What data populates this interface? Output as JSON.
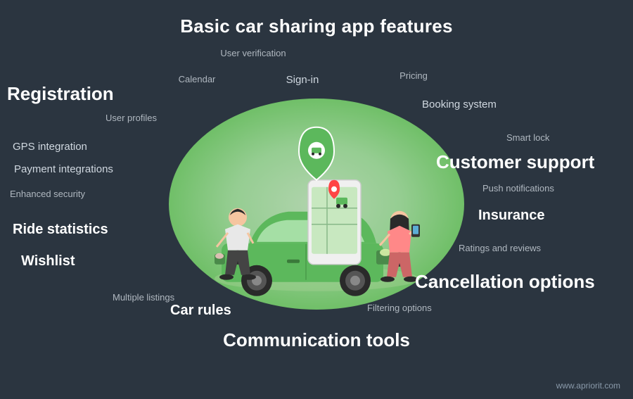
{
  "title": "Basic car sharing app features",
  "features": {
    "registration": "Registration",
    "user_verification": "User verification",
    "calendar": "Calendar",
    "sign_in": "Sign-in",
    "pricing": "Pricing",
    "booking_system": "Booking system",
    "user_profiles": "User profiles",
    "gps_integration": "GPS integration",
    "payment_integrations": "Payment integrations",
    "smart_lock": "Smart lock",
    "customer_support": "Customer support",
    "enhanced_security": "Enhanced security",
    "push_notifications": "Push notifications",
    "insurance": "Insurance",
    "ride_statistics": "Ride statistics",
    "ratings_and_reviews": "Ratings and reviews",
    "wishlist": "Wishlist",
    "cancellation_options": "Cancellation options",
    "multiple_listings": "Multiple listings",
    "car_rules": "Car rules",
    "filtering_options": "Filtering options",
    "communication_tools": "Communication tools"
  },
  "watermark": "www.apriorit.com"
}
